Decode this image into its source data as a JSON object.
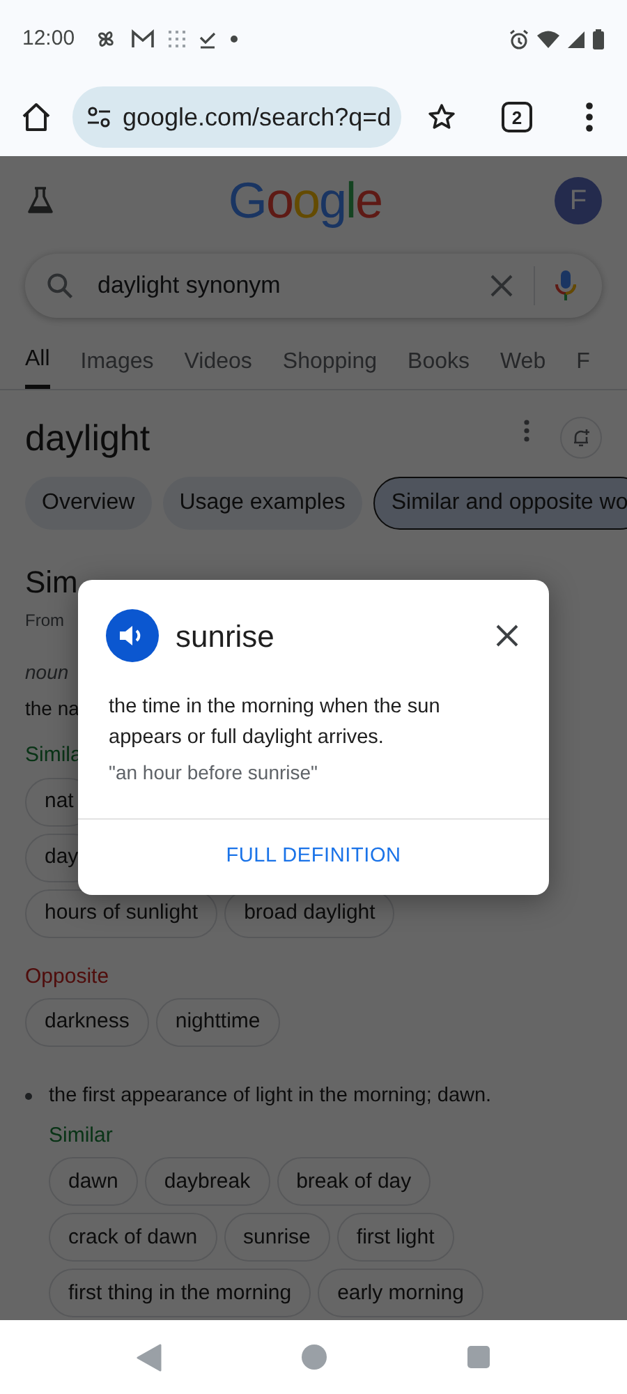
{
  "status_bar": {
    "time": "12:00"
  },
  "browser": {
    "url": "google.com/search?q=d",
    "tab_count": "2"
  },
  "header": {
    "logo": "Google",
    "avatar": "F"
  },
  "search": {
    "value": "daylight synonym"
  },
  "tabs": [
    {
      "label": "All",
      "selected": true
    },
    {
      "label": "Images",
      "selected": false
    },
    {
      "label": "Videos",
      "selected": false
    },
    {
      "label": "Shopping",
      "selected": false
    },
    {
      "label": "Books",
      "selected": false
    },
    {
      "label": "Web",
      "selected": false
    },
    {
      "label": "F",
      "selected": false
    }
  ],
  "word": {
    "title": "daylight"
  },
  "chips": [
    {
      "label": "Overview",
      "selected": false
    },
    {
      "label": "Usage examples",
      "selected": false
    },
    {
      "label": "Similar and opposite wo",
      "selected": true
    }
  ],
  "section": {
    "heading": "Sim",
    "source": "From",
    "pos": "noun",
    "definition": "the na"
  },
  "sense_1_groups": [
    {
      "kind": "similar",
      "label": "Simila",
      "rows": [
        [
          "nat"
        ],
        [
          "day"
        ],
        [
          "hours of sunlight",
          "broad daylight"
        ]
      ]
    },
    {
      "kind": "opposite",
      "label": "Opposite",
      "rows": [
        [
          "darkness",
          "nighttime"
        ]
      ]
    }
  ],
  "sense_2": {
    "definition": "the first appearance of light in the morning; dawn.",
    "groups": [
      {
        "kind": "similar",
        "label": "Similar",
        "chips": [
          "dawn",
          "daybreak",
          "break of day",
          "crack of dawn",
          "sunrise",
          "first light",
          "first thing in the morning",
          "early morning"
        ]
      }
    ]
  },
  "dialog": {
    "word": "sunrise",
    "definition": "the time in the morning when the sun appears or full daylight arrives.",
    "example": "\"an hour before sunrise\"",
    "action": "FULL DEFINITION"
  }
}
